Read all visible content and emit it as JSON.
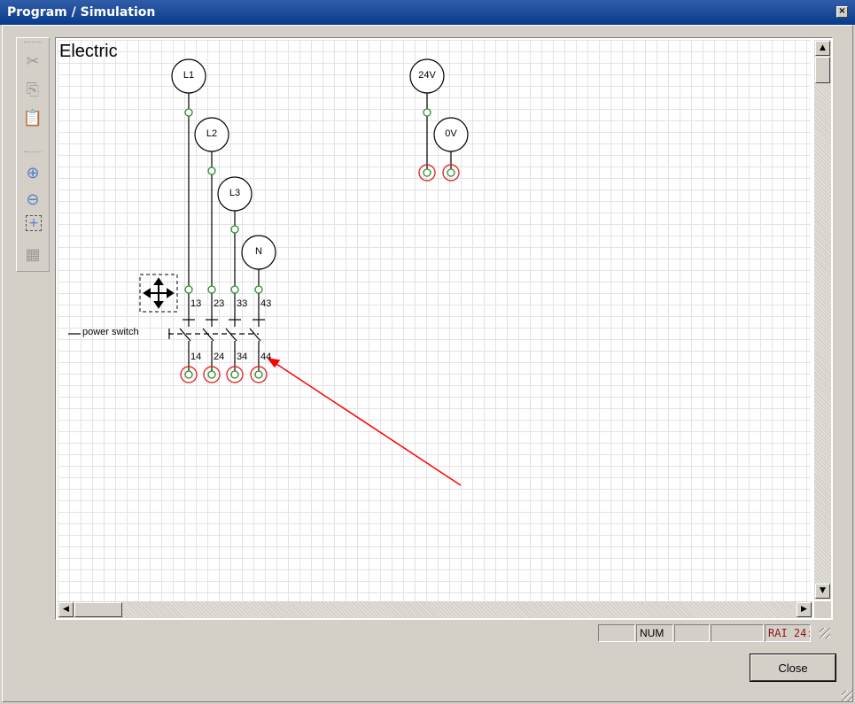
{
  "window": {
    "title": "Program / Simulation",
    "close_glyph": "×"
  },
  "toolbar": {
    "items": [
      "cut-icon",
      "copy-icon",
      "paste-icon",
      "zoom-in-icon",
      "zoom-out-icon",
      "zoom-fit-icon",
      "zoom-select-icon"
    ]
  },
  "diagram": {
    "sheet_title": "Electric",
    "supplies": [
      "L1",
      "L2",
      "L3",
      "N",
      "24V",
      "0V"
    ],
    "switch_label": "power switch",
    "top_terminals": [
      "13",
      "23",
      "33",
      "43"
    ],
    "bottom_terminals": [
      "14",
      "24",
      "34",
      "44"
    ]
  },
  "statusbar": {
    "panel1": "",
    "num": "NUM",
    "panel3": "",
    "panel4": "",
    "panel5": "RAI 24:"
  },
  "buttons": {
    "close": "Close"
  },
  "colors": {
    "title_bg": "#0a3a8c",
    "node_green": "#2e8b2e",
    "terminal_red": "#e03030",
    "arrow": "#ff0000"
  }
}
